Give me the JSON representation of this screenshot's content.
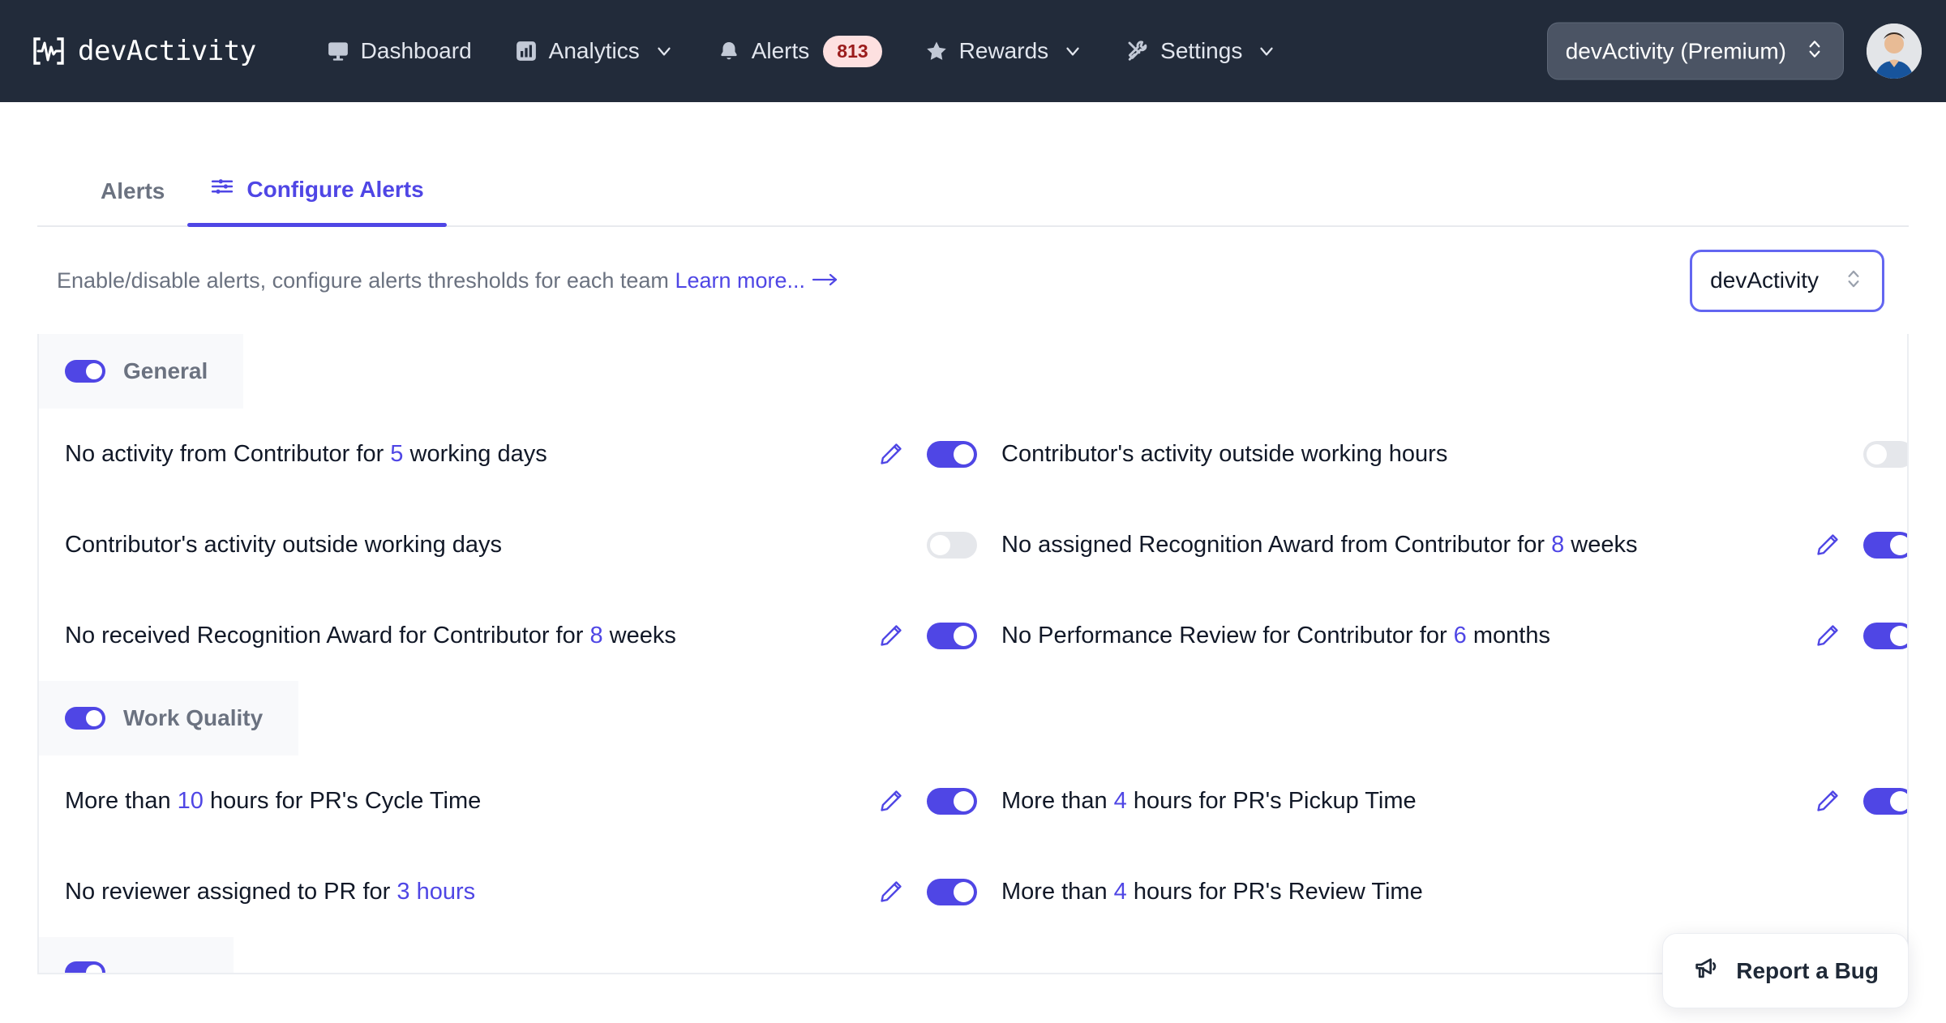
{
  "header": {
    "brand": "devActivity",
    "nav": [
      {
        "label": "Dashboard",
        "icon": "monitor-icon",
        "caret": false,
        "badge": null
      },
      {
        "label": "Analytics",
        "icon": "bar-chart-icon",
        "caret": true,
        "badge": null
      },
      {
        "label": "Alerts",
        "icon": "bell-icon",
        "caret": false,
        "badge": "813"
      },
      {
        "label": "Rewards",
        "icon": "star-icon",
        "caret": true,
        "badge": null
      },
      {
        "label": "Settings",
        "icon": "tools-icon",
        "caret": true,
        "badge": null
      }
    ],
    "workspace": "devActivity (Premium)",
    "avatar_alt": "user-avatar"
  },
  "tabs": [
    {
      "label": "Alerts",
      "active": false,
      "icon": null
    },
    {
      "label": "Configure Alerts",
      "active": true,
      "icon": "sliders-icon"
    }
  ],
  "subheader": {
    "description": "Enable/disable alerts, configure alerts thresholds for each team",
    "learn_more": "Learn more...",
    "team_selected": "devActivity"
  },
  "sections": [
    {
      "title": "General",
      "enabled": true,
      "rows": [
        {
          "left": {
            "text_parts": [
              {
                "t": "No activity from Contributor for ",
                "hl": false
              },
              {
                "t": "5",
                "hl": true
              },
              {
                "t": " working days",
                "hl": false
              }
            ],
            "editable": true,
            "enabled": true
          },
          "right": {
            "text_parts": [
              {
                "t": "Contributor's activity outside working hours",
                "hl": false
              }
            ],
            "editable": false,
            "enabled": false
          }
        },
        {
          "left": {
            "text_parts": [
              {
                "t": "Contributor's activity outside working days",
                "hl": false
              }
            ],
            "editable": false,
            "enabled": false
          },
          "right": {
            "text_parts": [
              {
                "t": "No assigned Recognition Award from Contributor for ",
                "hl": false
              },
              {
                "t": "8",
                "hl": true
              },
              {
                "t": " weeks",
                "hl": false
              }
            ],
            "editable": true,
            "enabled": true
          }
        },
        {
          "left": {
            "text_parts": [
              {
                "t": "No received Recognition Award for Contributor for ",
                "hl": false
              },
              {
                "t": "8",
                "hl": true
              },
              {
                "t": " weeks",
                "hl": false
              }
            ],
            "editable": true,
            "enabled": true
          },
          "right": {
            "text_parts": [
              {
                "t": "No Performance Review for Contributor for ",
                "hl": false
              },
              {
                "t": "6",
                "hl": true
              },
              {
                "t": " months",
                "hl": false
              }
            ],
            "editable": true,
            "enabled": true
          }
        }
      ]
    },
    {
      "title": "Work Quality",
      "enabled": true,
      "rows": [
        {
          "left": {
            "text_parts": [
              {
                "t": "More than ",
                "hl": false
              },
              {
                "t": "10",
                "hl": true
              },
              {
                "t": " hours for PR's Cycle Time",
                "hl": false
              }
            ],
            "editable": true,
            "enabled": true
          },
          "right": {
            "text_parts": [
              {
                "t": "More than ",
                "hl": false
              },
              {
                "t": "4",
                "hl": true
              },
              {
                "t": " hours for PR's Pickup Time",
                "hl": false
              }
            ],
            "editable": true,
            "enabled": true
          }
        },
        {
          "left": {
            "text_parts": [
              {
                "t": "No reviewer assigned to PR for ",
                "hl": false
              },
              {
                "t": "3 hours",
                "hl": true
              }
            ],
            "editable": true,
            "enabled": true
          },
          "right": {
            "text_parts": [
              {
                "t": "More than ",
                "hl": false
              },
              {
                "t": "4",
                "hl": true
              },
              {
                "t": " hours for PR's Review Time",
                "hl": false
              }
            ],
            "editable": false,
            "enabled": null
          }
        }
      ]
    },
    {
      "title": "",
      "enabled": true,
      "rows": []
    }
  ],
  "report_bug": {
    "label": "Report a Bug",
    "icon": "megaphone-icon"
  },
  "colors": {
    "nav_bg": "#222b3a",
    "accent": "#4f46e5",
    "badge_bg": "#fde0e0",
    "badge_text": "#9b1c1c",
    "toggle_off": "#e5e7eb",
    "section_bg": "#f8f9fb"
  }
}
